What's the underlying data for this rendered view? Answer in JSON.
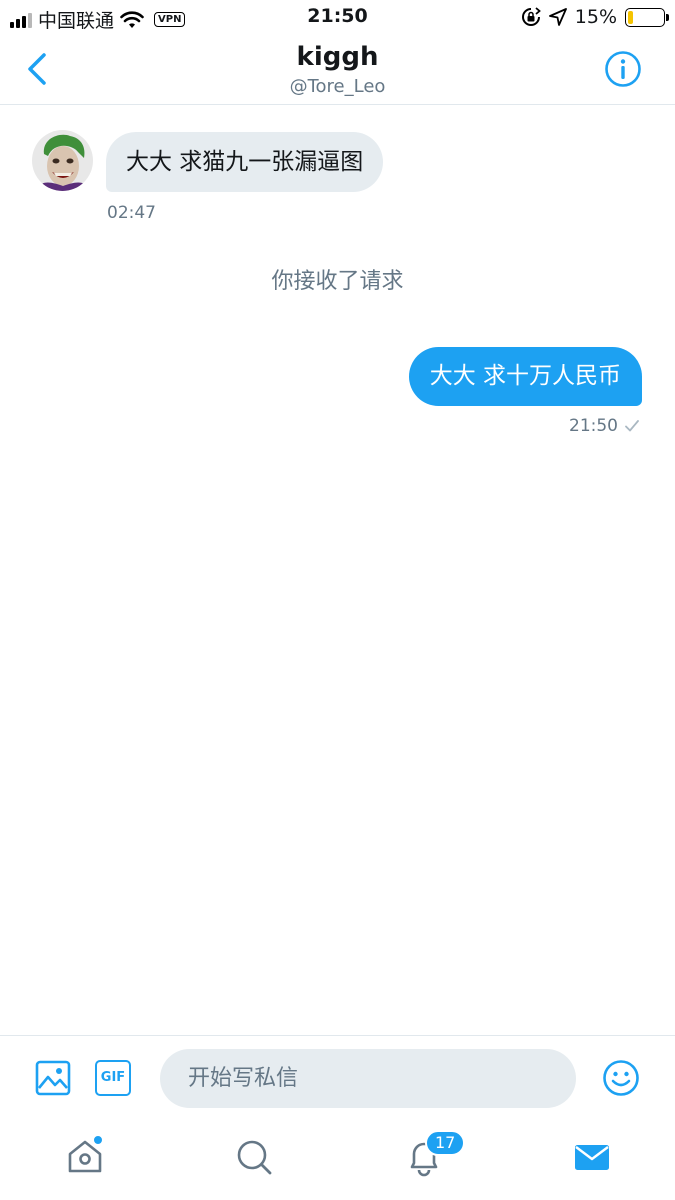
{
  "status_bar": {
    "carrier": "中国联通",
    "vpn": "VPN",
    "time": "21:50",
    "battery_percent": "15%",
    "battery_level": 0.15,
    "signal_bars": 3
  },
  "header": {
    "title": "kiggh",
    "handle": "@Tore_Leo"
  },
  "conversation": {
    "incoming": {
      "text": "大大 求猫九一张漏逼图",
      "time": "02:47"
    },
    "system_note": "你接收了请求",
    "outgoing": {
      "text": "大大 求十万人民币",
      "time": "21:50",
      "status_icon": "check-icon"
    }
  },
  "composer": {
    "gif_label": "GIF",
    "placeholder": "开始写私信"
  },
  "tabbar": {
    "notifications_badge": "17",
    "items": [
      "home-icon",
      "search-icon",
      "bell-icon",
      "mail-icon"
    ]
  },
  "colors": {
    "accent": "#1da1f2",
    "bubble_incoming": "#e6ecf0",
    "muted_text": "#657786"
  }
}
